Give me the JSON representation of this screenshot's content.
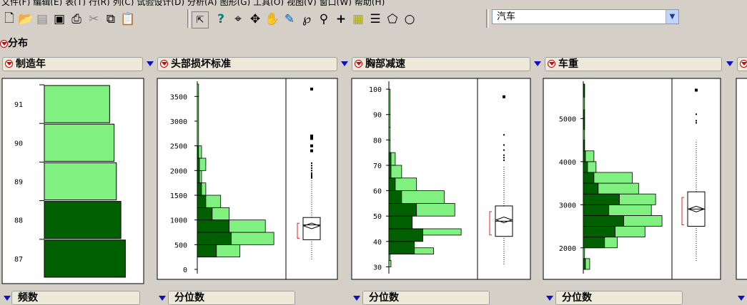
{
  "menubar": {
    "items": [
      "文件(F)",
      "编辑(E)",
      "表(T)",
      "行(R)",
      "列(C)",
      "试验设计(D)",
      "分析(A)",
      "图形(G)",
      "工具(O)",
      "视图(V)",
      "窗口(W)",
      "帮助(H)"
    ]
  },
  "toolbar": {
    "table_select": "汽车",
    "icons": [
      "new-file",
      "open-folder",
      "import",
      "save",
      "print",
      "cut",
      "copy",
      "paste",
      "arrow-select",
      "help",
      "crosshair",
      "move",
      "hand",
      "brush",
      "lasso",
      "magnifier",
      "plus",
      "annotate",
      "lines",
      "polygon",
      "circle"
    ]
  },
  "section_title": "分布",
  "panels": [
    {
      "title": "制造年",
      "footer": "频数"
    },
    {
      "title": "头部损坏标准",
      "footer": "分位数"
    },
    {
      "title": "胸部减速",
      "footer": "分位数"
    },
    {
      "title": "车重",
      "footer": "分位数"
    }
  ],
  "colors": {
    "bar_light": "#80f080",
    "bar_dark": "#006000",
    "bracket": "#e02020",
    "title_bar": "#ece9d8"
  },
  "chart_data": [
    {
      "type": "bar",
      "orientation": "horizontal",
      "categories": [
        "87",
        "88",
        "89",
        "90",
        "91"
      ],
      "values": [
        36,
        34,
        32,
        31,
        29
      ],
      "dark": [
        36,
        34,
        0,
        0,
        0
      ],
      "xlim": [
        0,
        40
      ]
    },
    {
      "type": "bar",
      "orientation": "horizontal",
      "bins_start": 0,
      "bin_width": 250,
      "values": [
        0,
        23,
        0,
        0,
        11,
        0,
        0,
        0,
        0,
        0,
        0,
        0
      ],
      "values_light": [
        0,
        0,
        0,
        0,
        0,
        0,
        0,
        0,
        0,
        0,
        0,
        0
      ],
      "ylim": [
        0,
        3750
      ],
      "yticks": [
        0,
        500,
        1000,
        1500,
        2000,
        2500,
        3000,
        3500
      ],
      "bars_light": [
        [
          250,
          500,
          20
        ],
        [
          500,
          750,
          36
        ],
        [
          750,
          1000,
          32
        ],
        [
          1000,
          1250,
          15
        ],
        [
          1250,
          1500,
          11
        ],
        [
          1500,
          1750,
          4
        ],
        [
          1750,
          2000,
          2
        ],
        [
          2000,
          2250,
          4
        ],
        [
          2250,
          2500,
          2
        ],
        [
          2500,
          3500,
          0.6
        ],
        [
          3500,
          3750,
          0.6
        ]
      ],
      "bars_dark": [
        [
          250,
          500,
          9
        ],
        [
          500,
          750,
          16
        ],
        [
          750,
          1000,
          15
        ],
        [
          1000,
          1250,
          7
        ],
        [
          1250,
          1500,
          4
        ],
        [
          1500,
          1750,
          2
        ],
        [
          1750,
          2000,
          1
        ],
        [
          2000,
          2250,
          1
        ],
        [
          2250,
          2500,
          0.6
        ]
      ],
      "xmax": 40,
      "box": {
        "q1": 600,
        "median": 900,
        "q3": 1050,
        "mean": 880,
        "whisker_low": 200,
        "whisker_high": 1800,
        "outliers": [
          1850,
          1870,
          1890,
          1920,
          1950,
          2000,
          2050,
          2100,
          2150,
          2400,
          2500,
          2650,
          2700,
          3650
        ]
      }
    },
    {
      "type": "bar",
      "orientation": "horizontal",
      "ylim": [
        29,
        102
      ],
      "yticks": [
        30,
        40,
        50,
        60,
        70,
        80,
        90,
        100
      ],
      "bars_light": [
        [
          30,
          32.5,
          1
        ],
        [
          32.5,
          35,
          0.6
        ],
        [
          35,
          37.5,
          21
        ],
        [
          37.5,
          40,
          0.6
        ],
        [
          40,
          42.5,
          0.6
        ],
        [
          42.5,
          45,
          34
        ],
        [
          45,
          47.5,
          0.6
        ],
        [
          47.5,
          50,
          0.6
        ],
        [
          50,
          55,
          31
        ],
        [
          55,
          60,
          26
        ],
        [
          60,
          65,
          13
        ],
        [
          65,
          70,
          6
        ],
        [
          70,
          75,
          3
        ],
        [
          75,
          80,
          0.6
        ],
        [
          80,
          85,
          0.6
        ],
        [
          85,
          90,
          0.6
        ],
        [
          90,
          100,
          0.6
        ]
      ],
      "bars_dark": [
        [
          35,
          40,
          12
        ],
        [
          40,
          45,
          16
        ],
        [
          45,
          50,
          11
        ],
        [
          50,
          55,
          13
        ],
        [
          55,
          60,
          6
        ],
        [
          60,
          65,
          3
        ],
        [
          65,
          70,
          1
        ],
        [
          70,
          75,
          1
        ]
      ],
      "xmax": 40,
      "box": {
        "q1": 42,
        "median": 48,
        "q3": 54,
        "mean": 48.5,
        "whisker_low": 31,
        "whisker_high": 70,
        "outliers": [
          72,
          73,
          74,
          76,
          78,
          82,
          97
        ]
      }
    },
    {
      "type": "bar",
      "orientation": "horizontal",
      "ylim": [
        1500,
        5800
      ],
      "yticks": [
        2000,
        3000,
        4000,
        5000
      ],
      "bars_light": [
        [
          1500,
          1750,
          3
        ],
        [
          1750,
          2000,
          0.6
        ],
        [
          2000,
          2250,
          16
        ],
        [
          2250,
          2500,
          29
        ],
        [
          2500,
          2750,
          37
        ],
        [
          2750,
          3000,
          32
        ],
        [
          3000,
          3250,
          34
        ],
        [
          3250,
          3500,
          26
        ],
        [
          3500,
          3750,
          23
        ],
        [
          3750,
          4000,
          6
        ],
        [
          4000,
          4250,
          5
        ],
        [
          4250,
          5000,
          0.6
        ],
        [
          5000,
          5500,
          0.6
        ],
        [
          5500,
          5800,
          0.6
        ]
      ],
      "bars_dark": [
        [
          1500,
          1750,
          1
        ],
        [
          2000,
          2250,
          10
        ],
        [
          2250,
          2500,
          15
        ],
        [
          2500,
          2750,
          19
        ],
        [
          2750,
          3000,
          12
        ],
        [
          3000,
          3250,
          17
        ],
        [
          3250,
          3500,
          7
        ],
        [
          3500,
          3750,
          5
        ],
        [
          3750,
          4000,
          2
        ],
        [
          4000,
          4250,
          1
        ],
        [
          4250,
          4500,
          0.6
        ],
        [
          4750,
          5000,
          0.6
        ],
        [
          5000,
          5200,
          0.6
        ],
        [
          5500,
          5800,
          0.6
        ]
      ],
      "xmax": 40,
      "box": {
        "q1": 2500,
        "median": 2900,
        "q3": 3300,
        "mean": 2900,
        "whisker_low": 1700,
        "whisker_high": 4500,
        "outliers": [
          4900,
          4950,
          5100,
          5650,
          5660
        ]
      }
    }
  ]
}
